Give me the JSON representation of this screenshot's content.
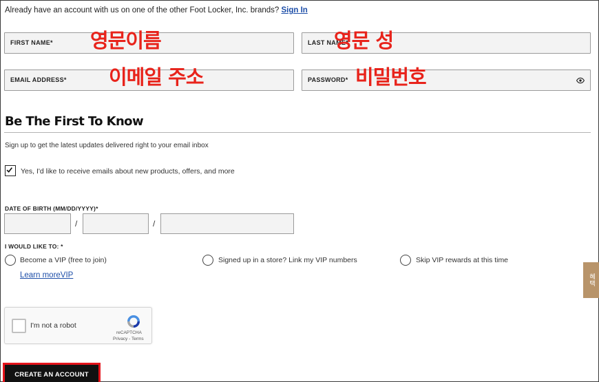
{
  "signin": {
    "prompt": "Already have an account with us on one of the other Foot Locker, Inc. brands?",
    "link": "Sign In"
  },
  "fields": {
    "first_name": {
      "label": "FIRST NAME*",
      "annotation": "영문이름"
    },
    "last_name": {
      "label": "LAST NAME*",
      "annotation": "영문 성"
    },
    "email": {
      "label": "EMAIL ADDRESS*",
      "annotation": "이메일 주소"
    },
    "password": {
      "label": "PASSWORD*",
      "annotation": "비밀번호",
      "toggle_icon": "eye-icon"
    }
  },
  "newsletter": {
    "title": "Be The First To Know",
    "subtitle": "Sign up to get the latest updates delivered right to your email inbox",
    "checkbox_label": "Yes, I'd like to receive emails about new products, offers, and more",
    "checked": true
  },
  "dob": {
    "label": "DATE OF BIRTH (MM/DD/YYYY)*",
    "separator": "/"
  },
  "vip": {
    "label": "I WOULD LIKE TO: *",
    "options": [
      "Become a VIP (free to join)",
      "Signed up in a store? Link my VIP numbers",
      "Skip VIP rewards at this time"
    ],
    "learn_more": "Learn moreVIP"
  },
  "captcha": {
    "label": "I'm not a robot",
    "brand": "reCAPTCHA",
    "terms": "Privacy - Terms"
  },
  "submit": {
    "label": "CREATE AN ACCOUNT",
    "highlight_color": "#e5141b"
  },
  "side_tab": {
    "label": "혜택"
  },
  "colors": {
    "annotation": "#e8231b",
    "link": "#1d4ea8"
  }
}
